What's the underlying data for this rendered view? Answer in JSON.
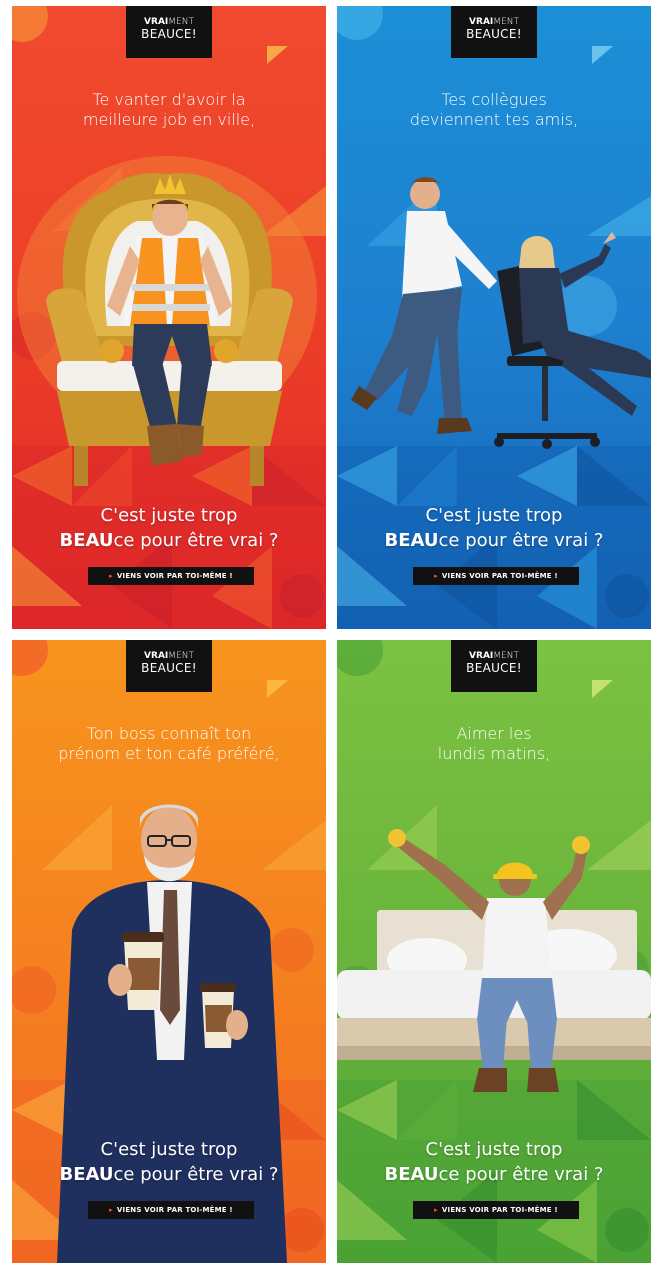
{
  "posters": [
    {
      "theme": "red",
      "colors": {
        "top": "#f04a2e",
        "mid": "#ea3c26",
        "bottom": "#e0292a",
        "accent": "#f7a13a"
      },
      "logo": {
        "line1_bold": "VRAI",
        "line1_light": "MENT",
        "line2": "BEAUCE!"
      },
      "headline": [
        "Te vanter d'avoir la",
        "meilleure job en ville,"
      ],
      "tagline": {
        "line1": "C'est juste trop",
        "bold": "BEAU",
        "line2_rest": "ce pour être vrai ?"
      },
      "cta": "VIENS VOIR PAR TOI-MÊME !",
      "figure": "worker-on-golden-throne"
    },
    {
      "theme": "blue",
      "colors": {
        "top": "#1b8fd6",
        "mid": "#1e7fd0",
        "bottom": "#1565b8",
        "accent": "#4fc0f0"
      },
      "logo": {
        "line1_bold": "VRAI",
        "line1_light": "MENT",
        "line2": "BEAUCE!"
      },
      "headline": [
        "Tes collègues",
        "deviennent tes amis,"
      ],
      "tagline": {
        "line1": "C'est juste trop",
        "bold": "BEAU",
        "line2_rest": "ce pour être vrai ?"
      },
      "cta": "VIENS VOIR PAR TOI-MÊME !",
      "figure": "colleagues-office-chair"
    },
    {
      "theme": "orange",
      "colors": {
        "top": "#f7941d",
        "mid": "#f58220",
        "bottom": "#f26b21",
        "accent": "#fbb040"
      },
      "logo": {
        "line1_bold": "VRAI",
        "line1_light": "MENT",
        "line2": "BEAUCE!"
      },
      "headline": [
        "Ton boss connaît ton",
        "prénom et ton café préféré,"
      ],
      "tagline": {
        "line1": "C'est juste trop",
        "bold": "BEAU",
        "line2_rest": "ce pour être vrai ?"
      },
      "cta": "VIENS VOIR PAR TOI-MÊME !",
      "figure": "boss-with-coffee"
    },
    {
      "theme": "green",
      "colors": {
        "top": "#7cc242",
        "mid": "#6ab43c",
        "bottom": "#4fa535",
        "accent": "#b4d96a"
      },
      "logo": {
        "line1_bold": "VRAI",
        "line1_light": "MENT",
        "line2": "BEAUCE!"
      },
      "headline": [
        "Aimer les",
        "lundis matins,"
      ],
      "tagline": {
        "line1": "C'est juste trop",
        "bold": "BEAU",
        "line2_rest": "ce pour être vrai ?"
      },
      "cta": "VIENS VOIR PAR TOI-MÊME !",
      "figure": "worker-on-bed"
    }
  ]
}
